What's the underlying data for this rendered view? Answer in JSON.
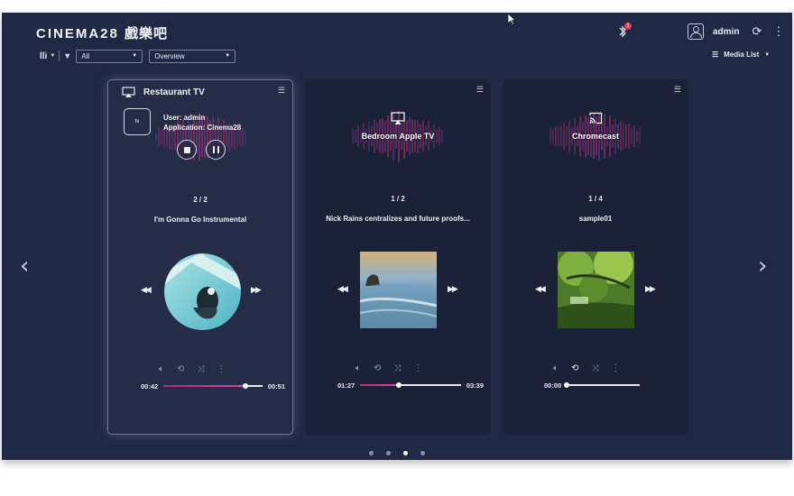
{
  "app": {
    "logo_latin": "CINEMA28",
    "logo_cjk": "戲樂吧",
    "bluetooth_badge": "1",
    "user_name": "admin"
  },
  "toolbar": {
    "filter_value": "All",
    "view_value": "Overview",
    "media_list_label": "Media List"
  },
  "cards": [
    {
      "device_name": "Restaurant TV",
      "device_type": "airplay",
      "session_user": "User: admin",
      "session_app": "Application: Cinema28",
      "app_badge": "tv",
      "track_count": "2 / 2",
      "track_title": "I'm Gonna Go Instrumental",
      "elapsed": "00:42",
      "duration": "00:51",
      "progress": 0.83,
      "repeat_on": false
    },
    {
      "device_name": "Bedroom Apple TV",
      "device_type": "airplay",
      "track_count": "1 / 2",
      "track_title": "Nick Rains centralizes and future proofs...",
      "elapsed": "01:27",
      "duration": "03:39",
      "progress": 0.38,
      "repeat_on": false
    },
    {
      "device_name": "Chromecast",
      "device_type": "chromecast",
      "track_count": "1 / 4",
      "track_title": "sample01",
      "elapsed": "00:00",
      "duration": "",
      "progress": 0.0,
      "repeat_on": true
    }
  ],
  "pagination": {
    "pages": 4,
    "active": 2
  },
  "colors": {
    "background": "#1f2845",
    "accent": "#d24aa9",
    "wave_pink": "#c8306f",
    "wave_purple": "#6a3fb0"
  }
}
